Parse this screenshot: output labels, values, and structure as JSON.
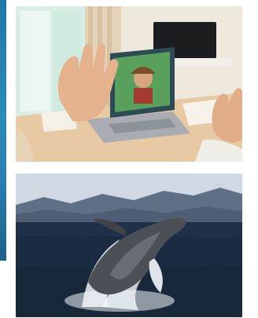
{
  "layout": {
    "photos": [
      {
        "role": "video-call-scene",
        "colors": {
          "wall": "#efe8dc",
          "window_light": "#d9efe6",
          "desk": "#e7c9a4",
          "laptop": "#b9bcc2",
          "tv": "#1b1d20",
          "hand": "#e4b38d"
        }
      },
      {
        "role": "whale-breaching-scene",
        "colors": {
          "sky": "#cfd8e3",
          "mountain": "#5f6f86",
          "sea": "#1f3048",
          "whale": "#4b4f56",
          "spray": "#eef3f8"
        }
      }
    ]
  }
}
